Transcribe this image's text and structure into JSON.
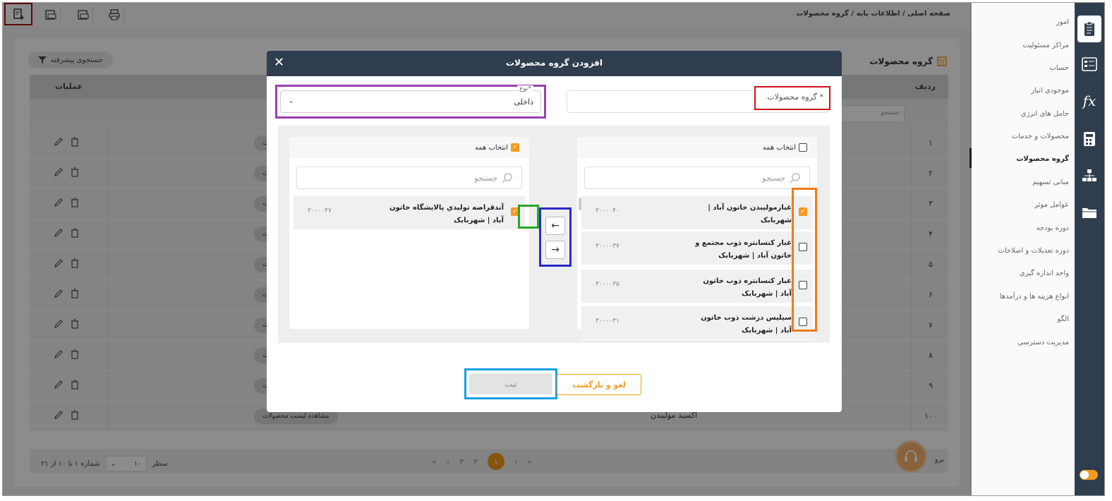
{
  "breadcrumb": "صفحه اصلی / اطلاعات پایه / گروه محصولات",
  "sidebar": {
    "items": [
      {
        "label": "امور"
      },
      {
        "label": "مراکز مسئولیت"
      },
      {
        "label": "حساب"
      },
      {
        "label": "موجودی انبار"
      },
      {
        "label": "حامل های انرژی"
      },
      {
        "label": "محصولات و خدمات"
      },
      {
        "label": "گروه محصولات"
      },
      {
        "label": "مبانی تسهیم"
      },
      {
        "label": "عوامل موثر"
      },
      {
        "label": "دوره بودجه"
      },
      {
        "label": "دوره تعدیلات و اصلاحات"
      },
      {
        "label": "واحد اندازه گیری"
      },
      {
        "label": "انواع هزینه ها و درآمدها"
      },
      {
        "label": "الگو"
      },
      {
        "label": "مدیریت دسترسی"
      }
    ],
    "active_index": 6
  },
  "page": {
    "title": "گروه محصولات",
    "advanced_search": "جستجوی پیشرفته"
  },
  "table": {
    "columns": {
      "row": "ردیف",
      "actions": "عملیات"
    },
    "filter_placeholder": "جستجو",
    "rows": [
      {
        "num": "۱",
        "name": ""
      },
      {
        "num": "۲",
        "name": ""
      },
      {
        "num": "۳",
        "name": ""
      },
      {
        "num": "۴",
        "name": ""
      },
      {
        "num": "۵",
        "name": ""
      },
      {
        "num": "۶",
        "name": ""
      },
      {
        "num": "۷",
        "name": ""
      },
      {
        "num": "۸",
        "name": ""
      },
      {
        "num": "۹",
        "name": ""
      },
      {
        "num": "۱۰",
        "name": "اکسید مولیبدن"
      }
    ],
    "view_button_label": "مشاهده لیست محصولات",
    "view_button_partial": "ت"
  },
  "pager": {
    "info": "شماره ۱ تا ۱۰ از ۲۱",
    "page_size": "۱۰",
    "page_size_label": "سطر",
    "pages": [
      "۳",
      "۲",
      "۱"
    ],
    "active_page": "۱",
    "goto_label": "برو"
  },
  "modal": {
    "title": "افزودن گروه محصولات",
    "close": "✕",
    "group_name_label": "گروه محصولات *",
    "type_label": "نوع*",
    "type_value": "داخلی",
    "select_all": "انتخاب همه",
    "search_placeholder": "جستجو",
    "source_items": [
      {
        "text": "غبارمولیبدن خاتون آباد | شهربابک",
        "code": "۳۰۰۰۰۴۰",
        "checked": true
      },
      {
        "text": "غبار کنسانتره ذوب مجتمع و خاتون آباد | شهربابک",
        "code": "۳۰۰۰۰۳۷",
        "checked": false
      },
      {
        "text": "غبار کنسانتره ذوب خاتون آباد | شهربابک",
        "code": "۳۰۰۰۰۳۵",
        "checked": false
      },
      {
        "text": "سیلیس درشت ذوب خاتون آباد | شهربابک",
        "code": "۳۰۰۰۰۳۱",
        "checked": false
      }
    ],
    "target_items": [
      {
        "text": "آندقراضه توليدي پالايشگاه خاتون آباد | شهربابک",
        "code": "۳۰۰۰۰۴۷",
        "checked": true
      }
    ],
    "move_left": "←",
    "move_right": "→",
    "submit_label": "ثبت",
    "cancel_label": "لغو و بازگشت"
  },
  "colors": {
    "accent": "#f29b1e",
    "header": "#2f3e4e"
  }
}
